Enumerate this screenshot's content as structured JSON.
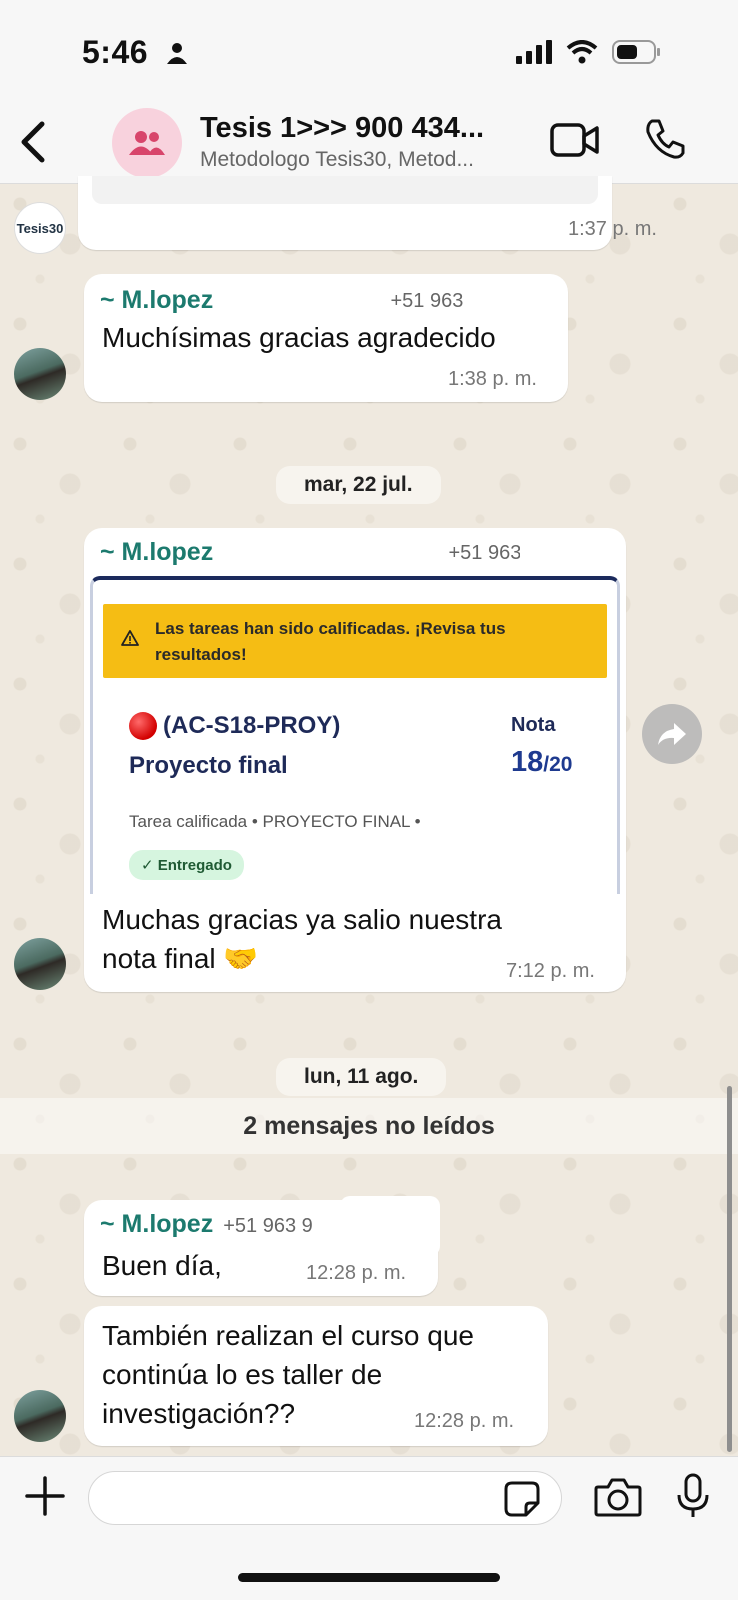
{
  "status_bar": {
    "time": "5:46"
  },
  "header": {
    "title": "Tesis 1>>> 900 434...",
    "subtitle": "Metodologo Tesis30, Metod..."
  },
  "messages": {
    "first": {
      "time": "1:37 p. m.",
      "avatar_text": "Tesis30"
    },
    "second": {
      "sender": "~ M.lopez",
      "phone": "+51 963 9",
      "text": "Muchísimas gracias agradecido",
      "time": "1:38 p. m."
    },
    "third": {
      "sender": "~ M.lopez",
      "phone": "+51 963 9",
      "text_line1": "Muchas gracias ya salio nuestra",
      "text_line2": "nota final 🤝",
      "time": "7:12 p. m."
    },
    "fourth": {
      "sender": "~ M.lopez",
      "phone": "+51 963 9",
      "text": "Buen día,",
      "time": "12:28 p. m."
    },
    "fifth": {
      "text_line1": "También realizan el curso que",
      "text_line2": "continúa lo es taller de",
      "text_line3": "investigación??",
      "time": "12:28 p. m."
    }
  },
  "dates": {
    "first": "mar, 22 jul.",
    "second": "lun, 11 ago."
  },
  "unread": "2 mensajes no leídos",
  "card": {
    "alert": "Las tareas han sido calificadas. ¡Revisa tus resultados!",
    "code": "(AC-S18-PROY)",
    "name": "Proyecto final",
    "nota_label": "Nota",
    "nota_score": "18",
    "nota_total": "/20",
    "meta": "Tarea calificada  •  PROYECTO FINAL  •",
    "badge": "✓  Entregado"
  },
  "colors": {
    "sender": "#1c7a6e",
    "accent_pink": "#f8d2dd",
    "card_alert": "#f5bd14"
  },
  "icons": [
    "back-icon",
    "group-icon",
    "video-call-icon",
    "phone-icon",
    "share-icon",
    "plus-icon",
    "sticker-icon",
    "camera-icon",
    "mic-icon"
  ]
}
